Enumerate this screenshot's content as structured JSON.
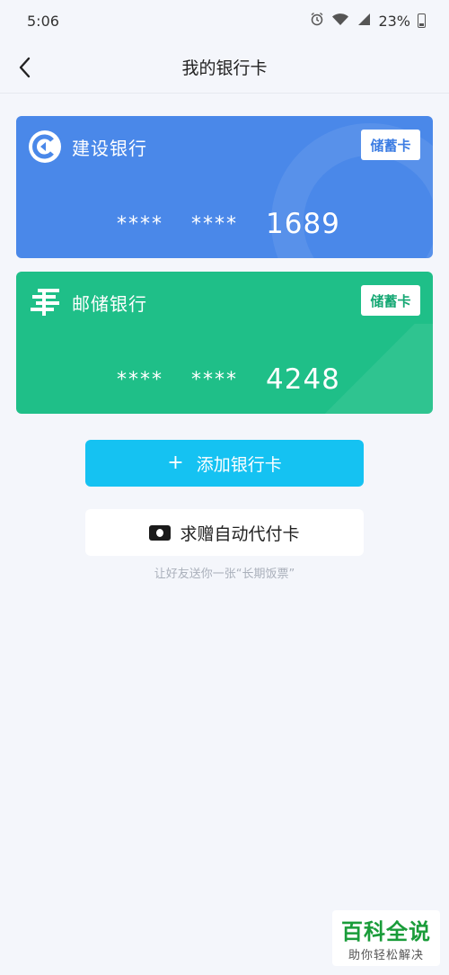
{
  "status_bar": {
    "time": "5:06",
    "battery": "23%"
  },
  "nav": {
    "title": "我的银行卡"
  },
  "cards": [
    {
      "bank_name": "建设银行",
      "card_type": "储蓄卡",
      "mask1": "****",
      "mask2": "****",
      "last4": "1689",
      "color": "#4a88e9"
    },
    {
      "bank_name": "邮储银行",
      "card_type": "储蓄卡",
      "mask1": "****",
      "mask2": "****",
      "last4": "4248",
      "color": "#1fbf88"
    }
  ],
  "actions": {
    "add_card_plus": "+",
    "add_card_label": "添加银行卡",
    "gift_card_label": "求赠自动代付卡",
    "hint": "让好友送你一张“长期饭票”"
  },
  "watermark": {
    "main": "百科全说",
    "sub": "助你轻松解决"
  }
}
